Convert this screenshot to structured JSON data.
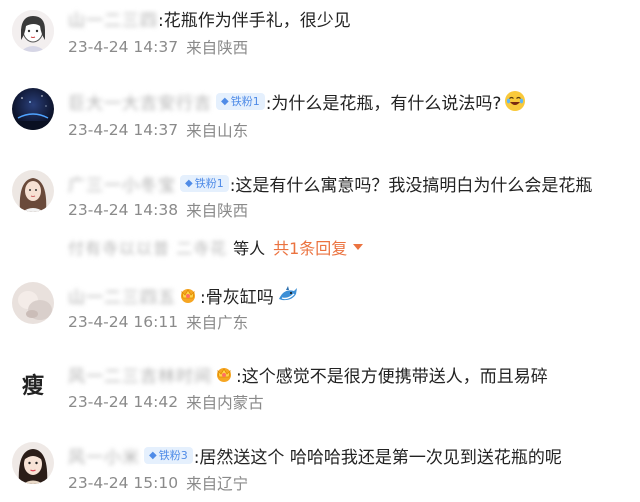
{
  "comments": [
    {
      "username": "山一二三四",
      "badge": null,
      "text": ":花瓶作为伴手礼，很少见",
      "time": "23-4-24 14:37",
      "location": "来自陕西",
      "avatar_icon": "girl-sketch-avatar"
    },
    {
      "username": "巨大一大吉安行吉",
      "badge": "铁粉1",
      "text": ":为什么是花瓶，有什么说法吗?",
      "emoji": "laughing-tears-emoji",
      "time": "23-4-24 14:37",
      "location": "来自山东",
      "avatar_icon": "night-sky-avatar"
    },
    {
      "username": "广三一小冬宝",
      "badge": "铁粉1",
      "text": ":这是有什么寓意吗？我没搞明白为什么会是花瓶",
      "time": "23-4-24 14:38",
      "location": "来自陕西",
      "avatar_icon": "woman-portrait-avatar"
    },
    {
      "username": "山一二三四五",
      "badge": null,
      "crown": true,
      "text": ":骨灰缸吗",
      "emoji": "shark-emoji",
      "time": "23-4-24 16:11",
      "location": "来自广东",
      "avatar_icon": "pastel-photo-avatar"
    },
    {
      "username": "风一二三吉林时间",
      "badge": null,
      "crown": true,
      "text": ":这个感觉不是很方便携带送人，而且易碎",
      "time": "23-4-24 14:42",
      "location": "来自内蒙古",
      "avatar_icon": "shou-character-avatar",
      "avatar_text": "瘦"
    },
    {
      "username": "风一小米",
      "badge": "铁粉3",
      "text": ":居然送这个 哈哈哈我还是第一次见到送花瓶的呢",
      "time": "23-4-24 15:10",
      "location": "来自辽宁",
      "avatar_icon": "girl-photo-avatar"
    }
  ],
  "reply_summary": {
    "names": "付有寺以以普 二寺花",
    "suffix": "等人",
    "more": "共1条回复"
  }
}
